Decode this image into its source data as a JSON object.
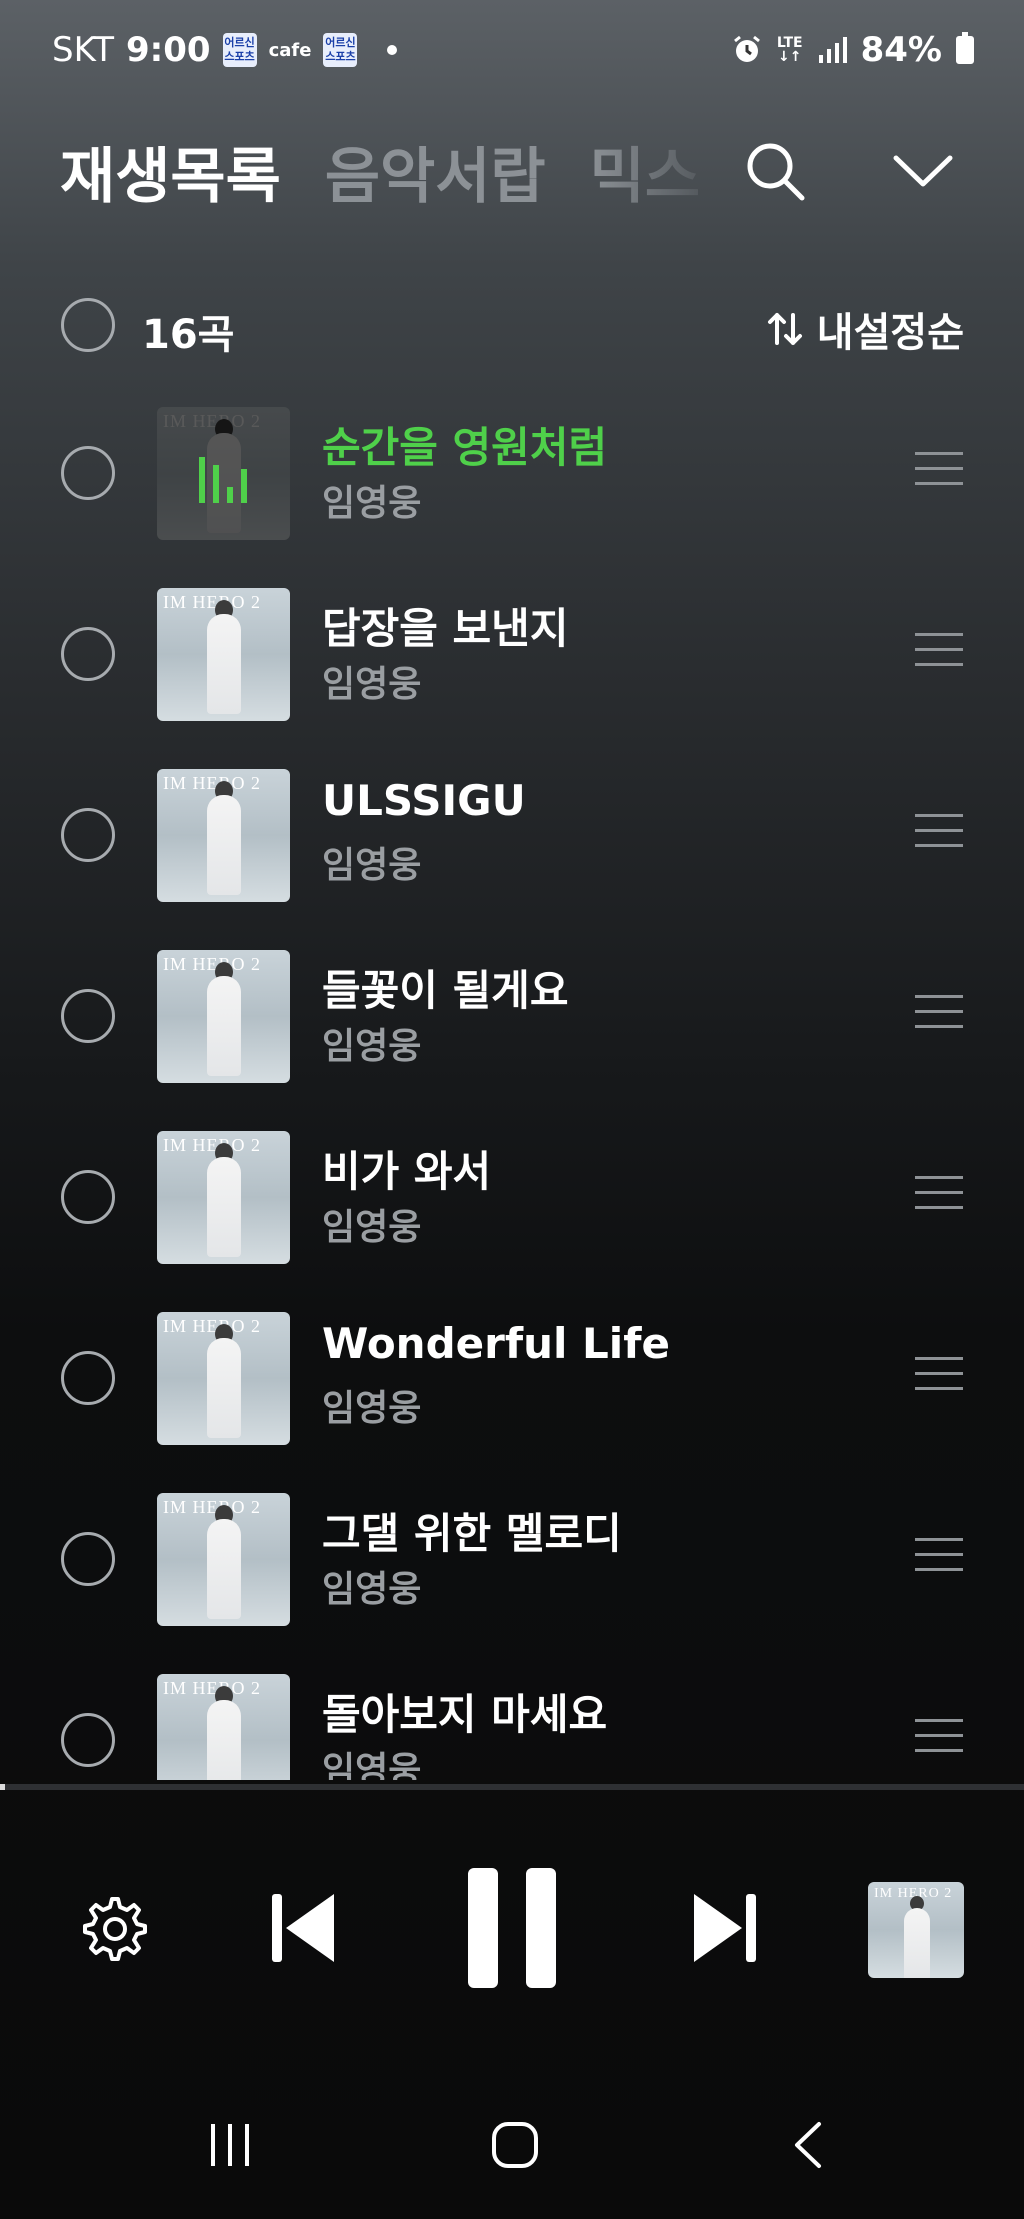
{
  "status_bar": {
    "carrier": "SKT",
    "time": "9:00",
    "badge1": "어르신 스포츠",
    "cafe": "cafe",
    "badge2": "어르신 스포츠",
    "network": "LTE",
    "battery": "84%"
  },
  "tabs": [
    {
      "label": "재생목록",
      "active": true
    },
    {
      "label": "음악서랍",
      "active": false
    },
    {
      "label": "믹스",
      "active": false
    }
  ],
  "list_header": {
    "count": "16곡",
    "sort_label": "내설정순"
  },
  "album_cover_text": "IM HERO 2",
  "songs": [
    {
      "title": "순간을 영원처럼",
      "artist": "임영웅",
      "playing": true
    },
    {
      "title": "답장을 보낸지",
      "artist": "임영웅",
      "playing": false
    },
    {
      "title": "ULSSIGU",
      "artist": "임영웅",
      "playing": false
    },
    {
      "title": "들꽃이 될게요",
      "artist": "임영웅",
      "playing": false
    },
    {
      "title": "비가 와서",
      "artist": "임영웅",
      "playing": false
    },
    {
      "title": "Wonderful Life",
      "artist": "임영웅",
      "playing": false
    },
    {
      "title": "그댈 위한 멜로디",
      "artist": "임영웅",
      "playing": false
    },
    {
      "title": "돌아보지 마세요",
      "artist": "임영웅",
      "playing": false
    }
  ],
  "playback_progress": 0.005,
  "colors": {
    "playing": "#4fd04a",
    "artist": "#9a9ea2",
    "inactive_tab": "#8c9196"
  }
}
